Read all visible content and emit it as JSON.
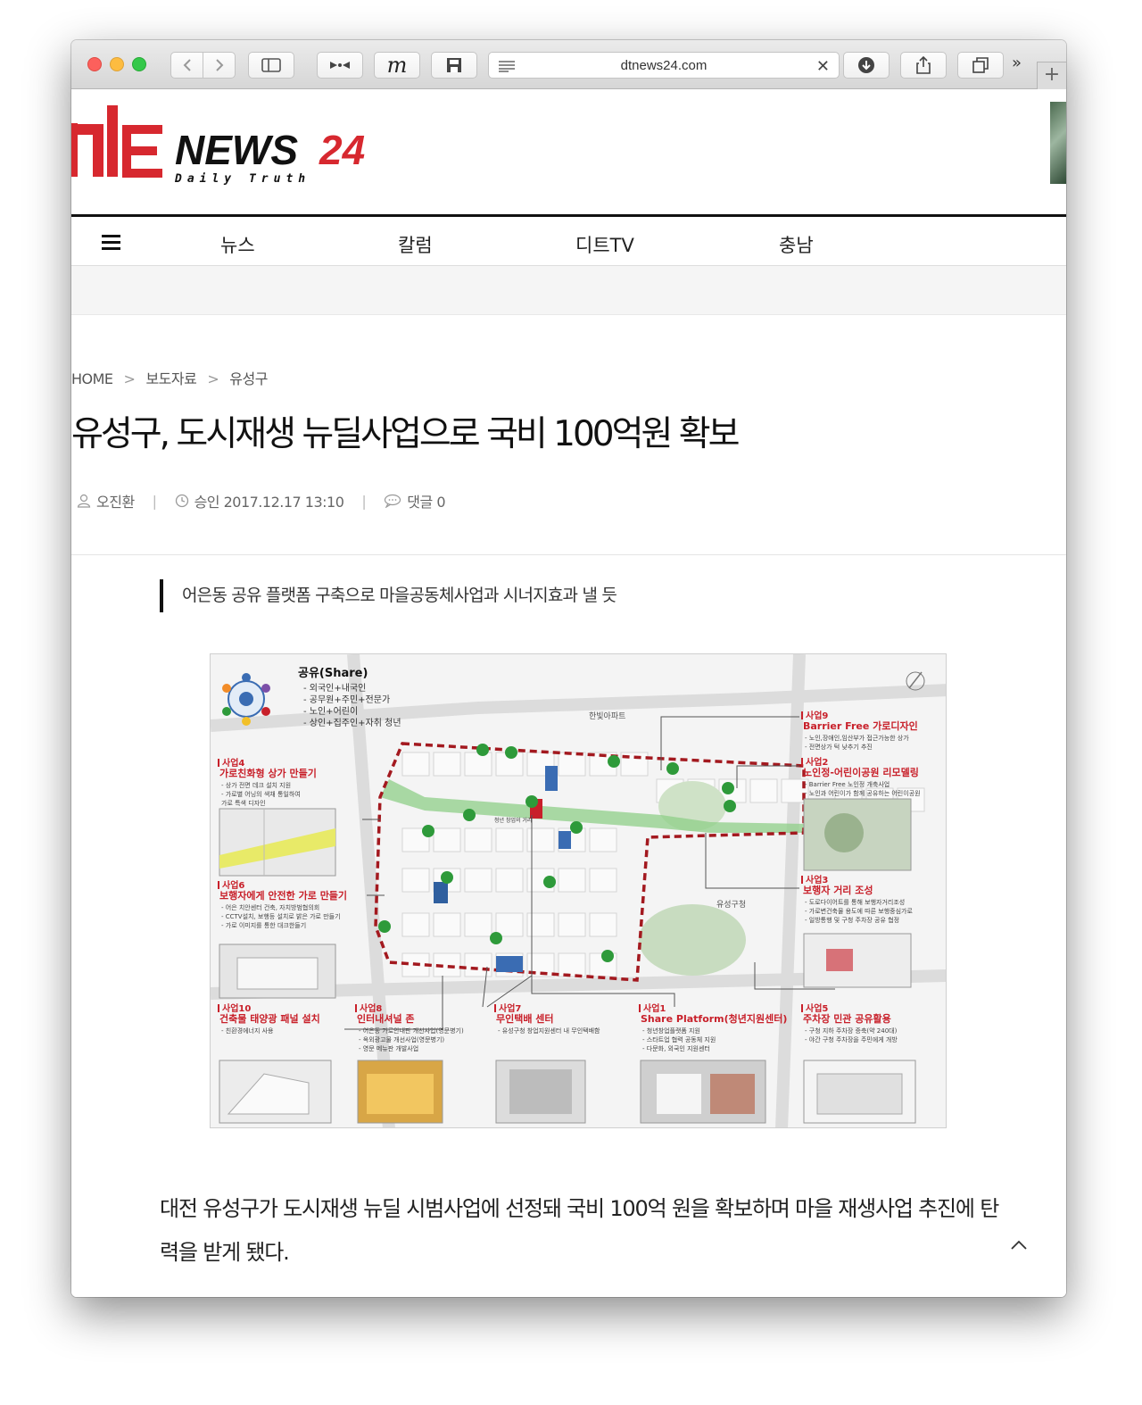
{
  "browser": {
    "url": "dtnews24.com"
  },
  "site": {
    "logo_mark": "디트",
    "logo_news": "NEWS",
    "logo_num": "24",
    "logo_tagline": "Daily Truth"
  },
  "nav": {
    "items": [
      "뉴스",
      "칼럼",
      "디트TV",
      "충남"
    ]
  },
  "breadcrumb": {
    "home": "HOME",
    "section": "보도자료",
    "sub": "유성구"
  },
  "article": {
    "title": "유성구, 도시재생 뉴딜사업으로 국비 100억원 확보",
    "author": "오진환",
    "published": "승인 2017.12.17 13:10",
    "comments": "댓글 0",
    "subtitle": "어은동 공유 플랫폼 구축으로 마을공동체사업과 시너지효과 낼 듯",
    "body": "대전 유성구가 도시재생 뉴딜 시범사업에 선정돼 국비 100억 원을 확보하며 마을 재생사업 추진에 탄력을 받게 됐다."
  },
  "figure": {
    "share_title": "공유(Share)",
    "share_items": [
      "- 외국인+내국인",
      "- 공무원+주민+전문가",
      "- 노인+어린이",
      "- 상인+집주인+자취 청년"
    ],
    "labels": {
      "apt": "한빛아파트",
      "office": "유성구청",
      "center": "청년 창업의 거리"
    },
    "projects": [
      {
        "no": "사업9",
        "title": "Barrier Free 가로디자인",
        "lines": [
          "- 노인,장애인,임산부가 접근가능한 상가",
          "- 전면상가 턱 낮추기 추진"
        ]
      },
      {
        "no": "사업2",
        "title": "노인정-어린이공원 리모델링",
        "lines": [
          "- Barrier Free 노인정 개축사업",
          "- 노인과 어린이가 함께 공유하는 어린이공원"
        ]
      },
      {
        "no": "사업4",
        "title": "가로친화형 상가 만들기",
        "lines": [
          "- 상가 전면 데크 설치 지원",
          "- 가로별 어닝의 색채 통일하여",
          "  가로 특색 디자인"
        ]
      },
      {
        "no": "사업6",
        "title": "보행자에게 안전한 가로 만들기",
        "lines": [
          "- 어은 치안센터 건축, 자치방범협의회",
          "- CCTV설치, 보행등 설치로 밝은 가로 만들기",
          "- 가로 이미지를 통한 대크한들기"
        ]
      },
      {
        "no": "사업3",
        "title": "보행자 거리 조성",
        "lines": [
          "- 도로다이어트를 통해 보행자거리조성",
          "- 가로변건축물 용도에 따른 보행중심가로",
          "- 일방통행 및 구청 주차장 공유 협정"
        ]
      },
      {
        "no": "사업10",
        "title": "건축물 태양광 패널 설치",
        "lines": [
          "- 친환경에너지 사용"
        ]
      },
      {
        "no": "사업8",
        "title": "인터내셔널 존",
        "lines": [
          "- 어은동 가로안내판 개선사업(영문병기)",
          "- 옥외광고물 개선사업(영문병기)",
          "- 영문 메뉴판 개발사업"
        ]
      },
      {
        "no": "사업7",
        "title": "무인택배 센터",
        "lines": [
          "- 유성구청 창업지원센터 내 무인택배함"
        ]
      },
      {
        "no": "사업1",
        "title": "Share Platform(청년지원센터)",
        "lines": [
          "- 청년창업플랫폼 지원",
          "- 스타트업 협력 공동체 지원",
          "- 다문화, 외국인 지원센터"
        ]
      },
      {
        "no": "사업5",
        "title": "주차장 민관 공유활용",
        "lines": [
          "- 구청 지하 주차장 증축(약 240대)",
          "- 야간 구청 주차장을 주민에게 개방"
        ]
      }
    ]
  },
  "colors": {
    "accent_red": "#d7282f",
    "nav_border": "#111111",
    "map_red": "#a3191f",
    "map_green": "#6fbf6a"
  },
  "icons": {
    "author": "user-icon",
    "time": "clock-icon",
    "comment": "comment-icon",
    "menu": "hamburger-icon",
    "scroll_top": "chevron-up-icon"
  }
}
